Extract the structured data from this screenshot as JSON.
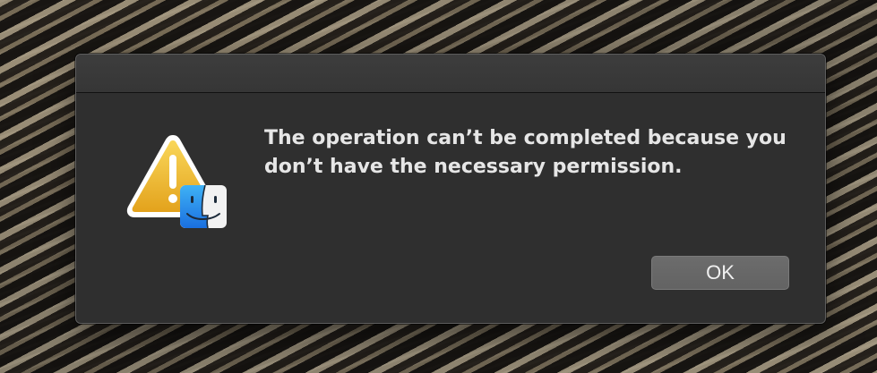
{
  "dialog": {
    "message": "The operation can’t be completed because you don’t have the necessary permission.",
    "ok_label": "OK",
    "icon": "caution-triangle-with-finder-badge-icon"
  },
  "colors": {
    "dialog_background": "#2f2f2f",
    "titlebar": "#3a3a3a",
    "button": "#676767",
    "text": "#e6e6e6",
    "warning_yellow": "#f0c13c"
  }
}
